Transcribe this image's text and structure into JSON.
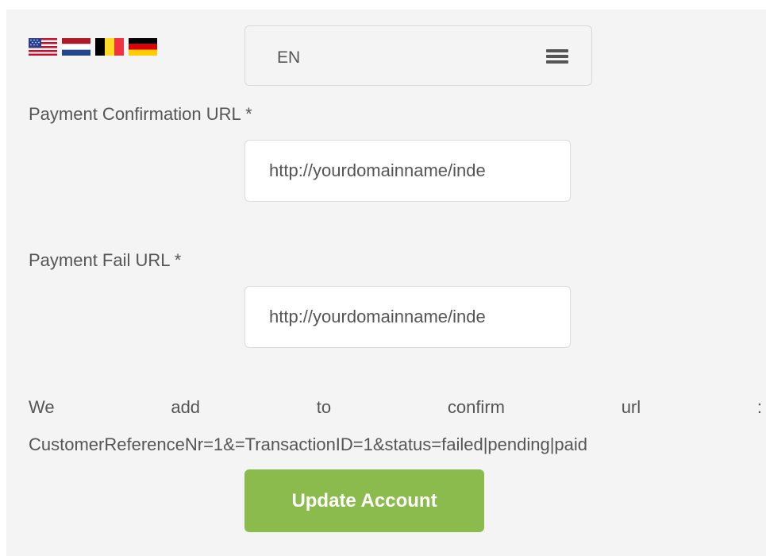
{
  "language": {
    "flags": [
      {
        "name": "us-flag-icon"
      },
      {
        "name": "netherlands-flag-icon"
      },
      {
        "name": "belgium-flag-icon"
      },
      {
        "name": "germany-flag-icon"
      }
    ],
    "selected": "EN",
    "menu_icon": "hamburger-menu-icon"
  },
  "form": {
    "confirm_label": "Payment Confirmation URL *",
    "confirm_value": "http://yourdomainname/inde",
    "fail_label": "Payment Fail URL *",
    "fail_value": "http://yourdomainname/inde",
    "info_words": [
      "We",
      "add",
      "to",
      "confirm",
      "url",
      ":"
    ],
    "info_params": "CustomerReferenceNr=1&=TransactionID=1&status=failed|pending|paid",
    "submit_label": "Update Account"
  },
  "colors": {
    "button": "#8bbb4c",
    "panel": "#f4f4f4",
    "text": "#555555"
  }
}
